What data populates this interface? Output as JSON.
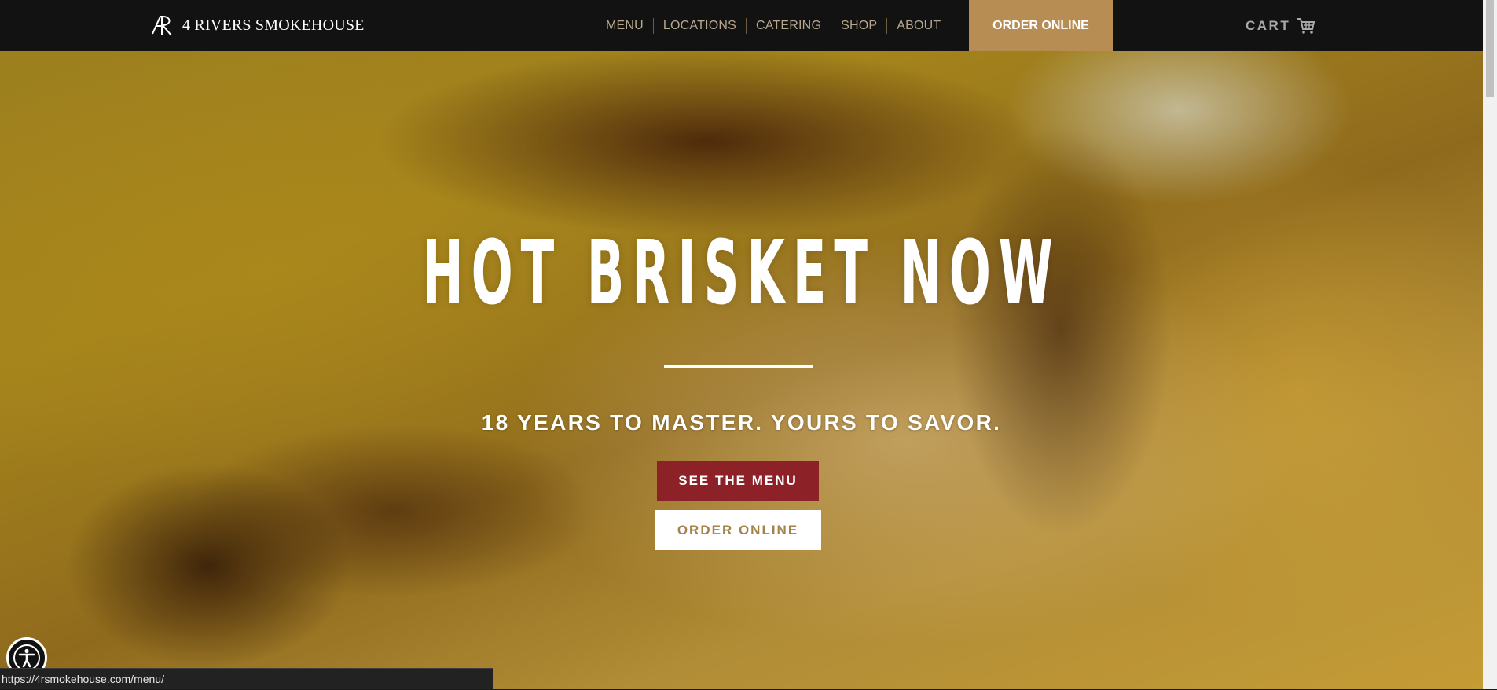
{
  "header": {
    "brand": "4 RIVERS SMOKEHOUSE",
    "nav": [
      {
        "label": "MENU"
      },
      {
        "label": "LOCATIONS"
      },
      {
        "label": "CATERING"
      },
      {
        "label": "SHOP"
      },
      {
        "label": "ABOUT"
      }
    ],
    "order_online": "ORDER ONLINE",
    "cart_label": "CART"
  },
  "hero": {
    "headline": "HOT BRISKET NOW",
    "tagline": "18 YEARS TO MASTER. YOURS TO SAVOR.",
    "primary_button": "SEE THE MENU",
    "secondary_button": "ORDER ONLINE"
  },
  "status_bar": {
    "url": "https://4rsmokehouse.com/menu/"
  },
  "colors": {
    "topbar": "#121212",
    "order_button": "#b78d54",
    "menu_button": "#8c2127",
    "nav_text": "#b6a78e",
    "order_outline_text": "#a3834a"
  },
  "icons": [
    "logo-mark-icon",
    "cart-icon",
    "accessibility-icon"
  ]
}
